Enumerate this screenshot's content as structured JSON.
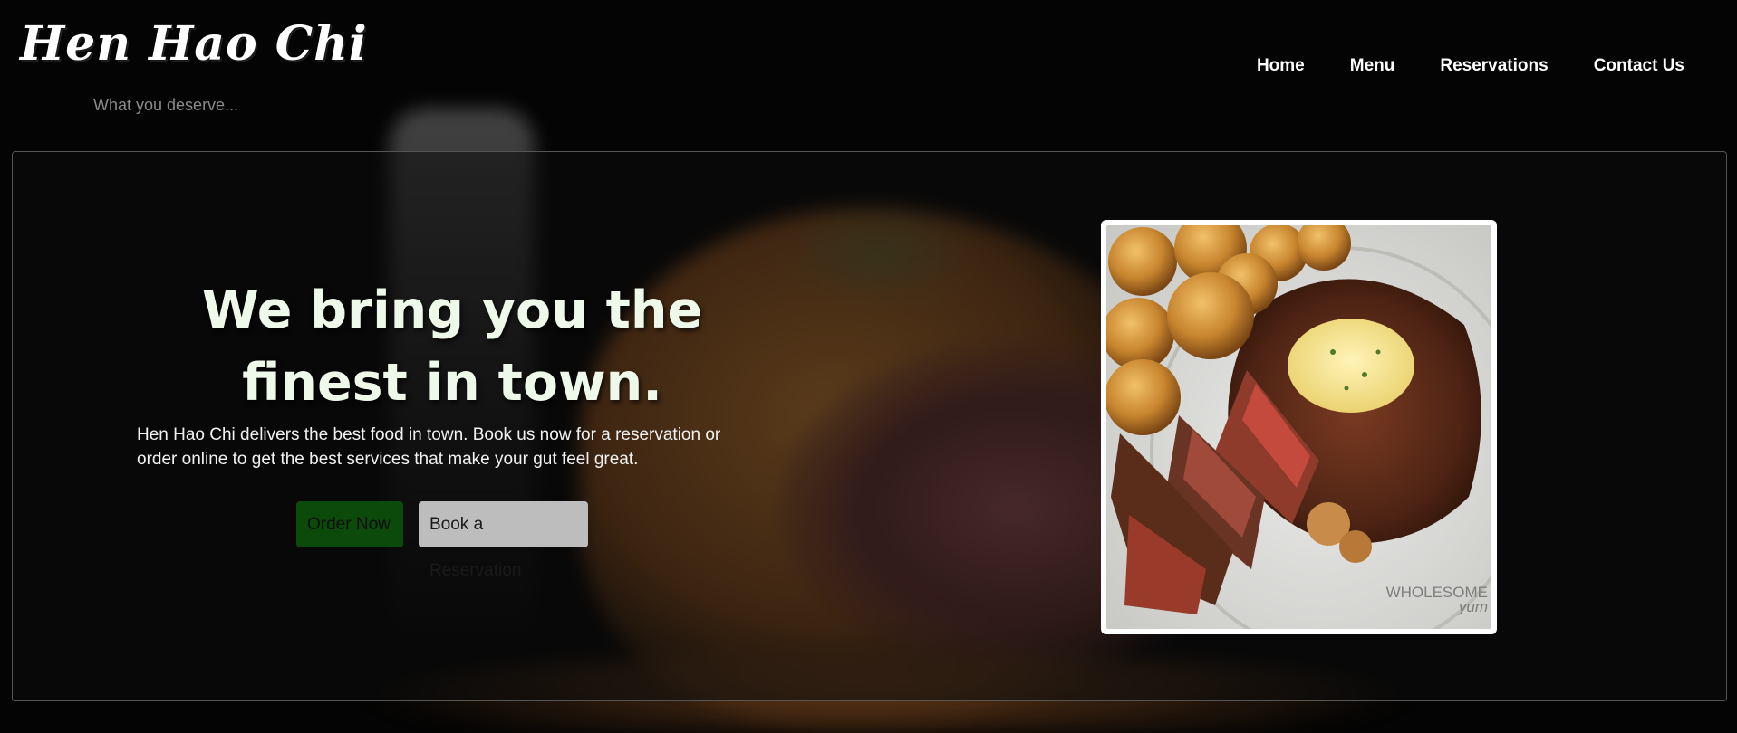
{
  "brand": {
    "logo_text": "Hen Hao Chi",
    "tagline": "What you deserve..."
  },
  "nav": {
    "items": [
      {
        "label": "Home"
      },
      {
        "label": "Menu"
      },
      {
        "label": "Reservations"
      },
      {
        "label": "Contact Us"
      }
    ]
  },
  "hero": {
    "headline": "We bring you the finest in town.",
    "description": "Hen Hao Chi delivers the best food in town. Book us now for a reservation or order online to get the best services that make your gut feel great.",
    "order_button_label": "Order Now",
    "reserve_button_label": "Book a Reservation",
    "photo_watermark_line1": "WHOLESOME",
    "photo_watermark_line2": "yum"
  },
  "colors": {
    "background": "#040404",
    "headline": "#eef9ea",
    "order_button": "#0b4a0b",
    "reserve_button": "#bdbdbd",
    "tagline": "#8a8a8a"
  }
}
